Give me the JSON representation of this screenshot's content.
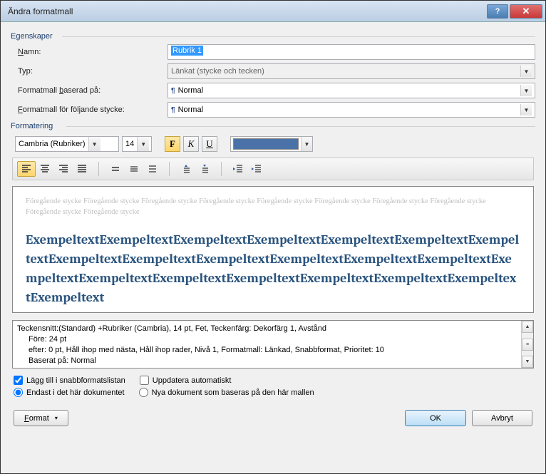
{
  "title": "Ändra formatmall",
  "groups": {
    "properties": "Egenskaper",
    "formatting": "Formatering"
  },
  "labels": {
    "name": "Namn:",
    "type": "Typ:",
    "based_on": "Formatmall baserad på:",
    "following": "Formatmall för följande stycke:"
  },
  "values": {
    "name": "Rubrik 1",
    "type": "Länkat (stycke och tecken)",
    "based_on": "Normal",
    "following": "Normal"
  },
  "font_controls": {
    "font_name": "Cambria (Rubriker)",
    "font_size": "14",
    "bold": "F",
    "italic": "K",
    "underline": "U",
    "color": "#4a72a8"
  },
  "preview": {
    "before_text": "Föregående stycke Föregående stycke Föregående stycke Föregående stycke Föregående stycke Föregående stycke Föregående stycke Föregående stycke Föregående stycke Föregående stycke",
    "sample_text": "ExempeltextExempeltextExempeltextExempeltextExempeltextExempeltextExempeltextExempeltextExempeltextExempeltextExempeltextExempeltextExempeltextExempeltextExempeltextExempeltextExempeltextExempeltextExempeltextExempeltextExempeltext"
  },
  "description": {
    "line1": "Teckensnitt:(Standard) +Rubriker (Cambria), 14 pt, Fet, Teckenfärg: Dekorfärg 1, Avstånd",
    "line2": "Före:  24 pt",
    "line3": "efter:  0 pt, Håll ihop med nästa, Håll ihop rader, Nivå 1, Formatmall: Länkad, Snabbformat, Prioritet: 10",
    "line4": "Baserat på: Normal"
  },
  "checkboxes": {
    "add_quick": "Lägg till i snabbformatslistan",
    "auto_update": "Uppdatera automatiskt"
  },
  "radios": {
    "this_doc": "Endast i det här dokumentet",
    "new_docs": "Nya dokument som baseras på den här mallen"
  },
  "buttons": {
    "format": "Format",
    "ok": "OK",
    "cancel": "Avbryt"
  }
}
